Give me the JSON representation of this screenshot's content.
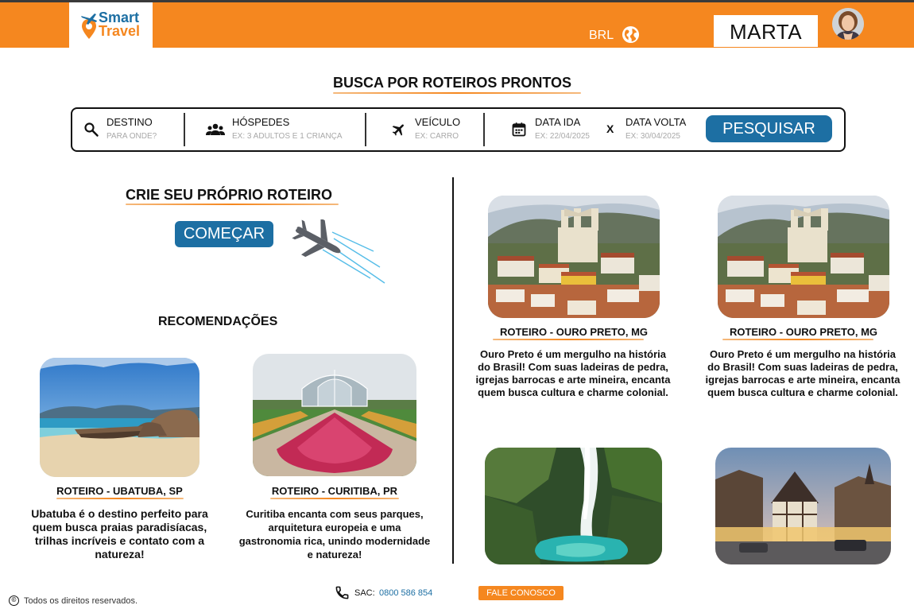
{
  "header": {
    "logo": {
      "line1": "Smart",
      "line2": "Travel"
    },
    "currency": "BRL",
    "user_name": "MARTA"
  },
  "search": {
    "title": "BUSCA POR ROTEIROS PRONTOS",
    "destination": {
      "label": "DESTINO",
      "placeholder": "PARA ONDE?"
    },
    "guests": {
      "label": "HÓSPEDES",
      "placeholder": "EX: 3 ADULTOS E 1 CRIANÇA"
    },
    "vehicle": {
      "label": "VEÍCULO",
      "placeholder": "EX: CARRO"
    },
    "date_out": {
      "label": "DATA IDA",
      "placeholder": "EX: 22/04/2025"
    },
    "separator": "X",
    "date_back": {
      "label": "DATA VOLTA",
      "placeholder": "EX: 30/04/2025"
    },
    "button": "PESQUISAR"
  },
  "create": {
    "title": "CRIE SEU PRÓPRIO ROTEIRO",
    "button": "COMEÇAR"
  },
  "recommendations": {
    "title": "RECOMENDAÇÕES",
    "items": [
      {
        "title": "ROTEIRO - UBATUBA, SP",
        "desc": "Ubatuba é o destino perfeito para quem busca praias paradisíacas, trilhas incríveis e contato com a natureza!"
      },
      {
        "title": "ROTEIRO - CURITIBA, PR",
        "desc": "Curitiba encanta com seus parques, arquitetura europeia e uma gastronomia rica, unindo modernidade e natureza!"
      }
    ]
  },
  "featured": [
    {
      "title": "ROTEIRO - OURO PRETO, MG",
      "desc": "Ouro Preto é um mergulho na história do Brasil! Com suas ladeiras de pedra, igrejas barrocas e arte mineira, encanta quem busca cultura e charme colonial."
    },
    {
      "title": "ROTEIRO - OURO PRETO, MG",
      "desc": "Ouro Preto é um mergulho na história do Brasil! Com suas ladeiras de pedra, igrejas barrocas e arte mineira, encanta quem busca cultura e charme colonial."
    }
  ],
  "footer": {
    "copyright_symbol": "©",
    "copyright": "Todos os direitos reservados.",
    "sac_label": "SAC:",
    "sac_number": "0800 586 854",
    "contact_button": "FALE CONOSCO"
  }
}
